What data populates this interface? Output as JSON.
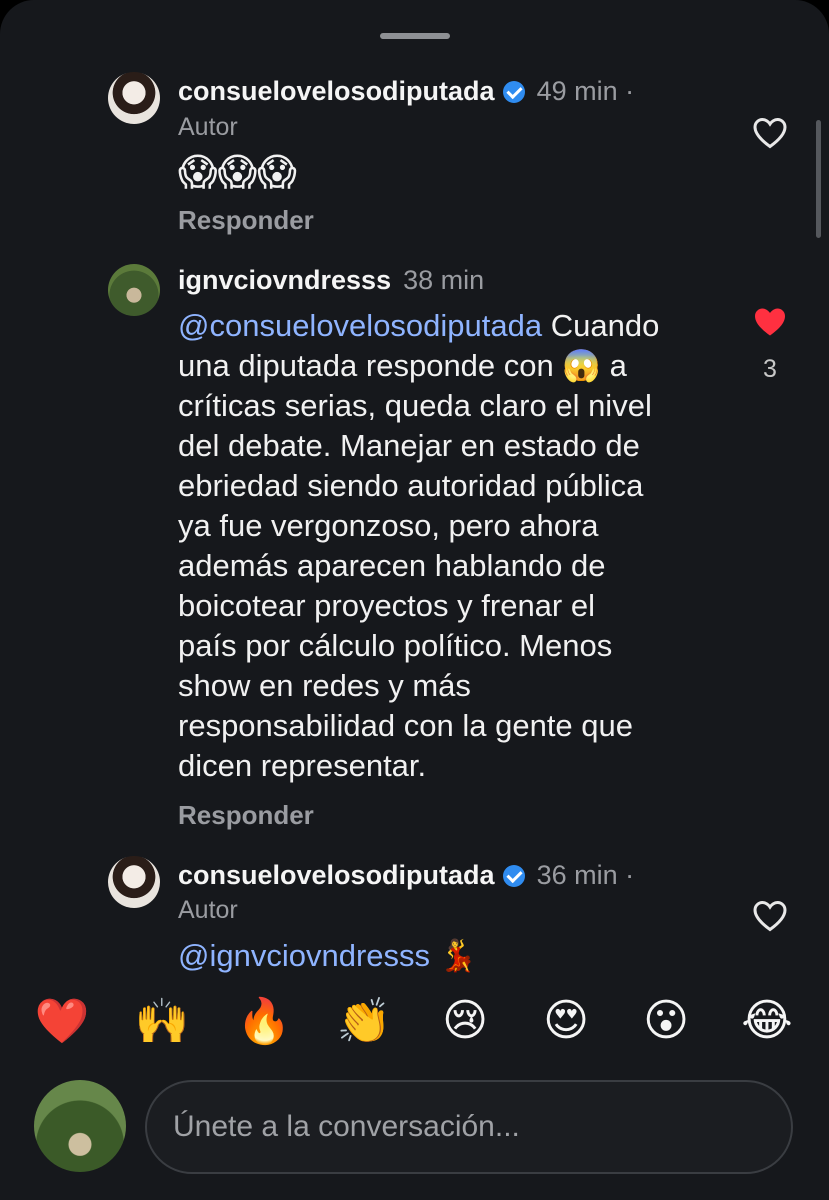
{
  "colors": {
    "background": "#16181c",
    "mention": "#8fb4ff",
    "verified": "#2f8cf0",
    "liked": "#ff3040"
  },
  "comments": [
    {
      "username": "consuelovelosodiputada",
      "verified": true,
      "time": "49 min ·",
      "badge": "Autor",
      "text": "😱😱😱",
      "reply": "Responder",
      "liked": false
    },
    {
      "username": "ignvciovndresss",
      "verified": false,
      "time": "38 min",
      "mention": "@consuelovelosodiputada",
      "text_lines": [
        " Cuando",
        "una diputada responde con 😱 a",
        "críticas serias, queda claro el nivel",
        "del debate. Manejar en estado de",
        "ebriedad siendo autoridad pública",
        "ya fue vergonzoso, pero ahora",
        "además aparecen hablando de",
        "boicotear proyectos y frenar el",
        "país por cálculo político. Menos",
        "show en redes y más",
        "responsabilidad con la gente que",
        "dicen representar."
      ],
      "reply": "Responder",
      "liked": true,
      "likes": "3"
    },
    {
      "username": "consuelovelosodiputada",
      "verified": true,
      "time": "36 min ·",
      "badge": "Autor",
      "mention": "@ignvciovndresss",
      "text": " 💃",
      "liked": false
    }
  ],
  "reactions": [
    "❤️",
    "🙌",
    "🔥",
    "👏",
    "😢",
    "😍",
    "😮",
    "😂"
  ],
  "composer": {
    "placeholder": "Únete a la conversación..."
  }
}
